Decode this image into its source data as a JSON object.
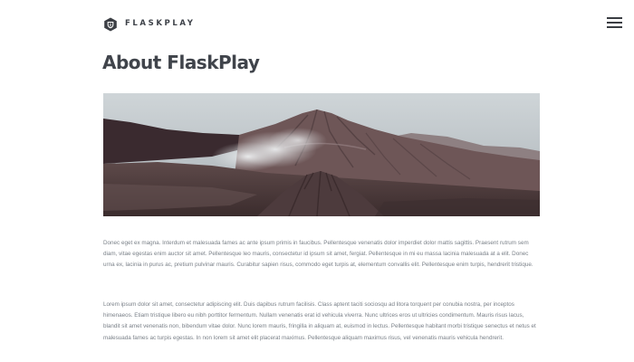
{
  "brand": {
    "name": "FLASKPLAY",
    "logo_icon": "hexagon-shield-icon"
  },
  "header": {
    "menu_icon": "hamburger-menu-icon"
  },
  "page": {
    "title": "About FlaskPlay"
  },
  "hero_image": {
    "subject": "volcanic mountain landscape with smoking crater"
  },
  "content": {
    "paragraphs": [
      "Donec eget ex magna. Interdum et malesuada fames ac ante ipsum primis in faucibus. Pellentesque venenatis dolor imperdiet dolor mattis sagittis. Praesent rutrum sem diam, vitae egestas enim auctor sit amet. Pellentesque leo mauris, consectetur id ipsum sit amet, fergiat. Pellentesque in mi eu massa lacinia malesuada at a elit. Donec urna ex, lacinia in purus ac, pretium pulvinar mauris. Curabitur sapien risus, commodo eget turpis at, elementum convallis elit. Pellentesque enim turpis, hendrerit tristique.",
      "Lorem ipsum dolor sit amet, consectetur adipiscing elit. Duis dapibus rutrum facilisis. Class aptent taciti sociosqu ad litora torquent per conubia nostra, per inceptos himenaeos. Etiam tristique libero eu nibh porttitor fermentum. Nullam venenatis erat id vehicula viverra. Nunc ultrices eros ut ultricies condimentum. Mauris risus lacus, blandit sit amet venenatis non, bibendum vitae dolor. Nunc lorem mauris, fringilla in aliquam at, euismod in lectus. Pellentesque habitant morbi tristique senectus et netus et malesuada fames ac turpis egestas. In non lorem sit amet elit placerat maximus. Pellentesque aliquam maximus risus, vel venenatis mauris vehicula hendrerit."
    ]
  },
  "colors": {
    "text_dark": "#40444b",
    "text_body": "#7a8088",
    "background": "#ffffff"
  }
}
